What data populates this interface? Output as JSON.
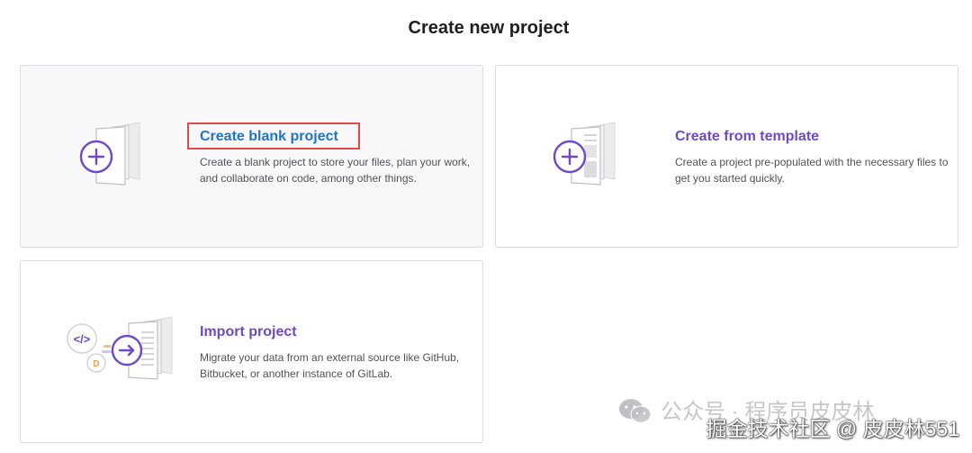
{
  "page": {
    "title": "Create new project"
  },
  "cards": {
    "blank": {
      "title": "Create blank project",
      "description": "Create a blank project to store your files, plan your work, and collaborate on code, among other things."
    },
    "template": {
      "title": "Create from template",
      "description": "Create a project pre-populated with the necessary files to get you started quickly."
    },
    "import": {
      "title": "Import project",
      "description": "Migrate your data from an external source like GitHub, Bitbucket, or another instance of GitLab.",
      "code_glyph": "</>",
      "small_badge": "D"
    }
  },
  "watermark": {
    "line1": "公众号 · 程序员皮皮林",
    "line2": "掘金技术社区 @ 皮皮林551"
  },
  "colors": {
    "accent_purple": "#6e49cb",
    "link_blue": "#1f75cb",
    "highlight_red": "#e04a4a",
    "orange": "#e9a14c"
  }
}
